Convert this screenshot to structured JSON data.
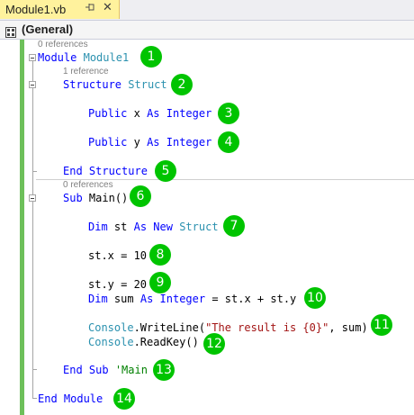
{
  "tab": {
    "title": "Module1.vb",
    "pin_icon": "pin-icon",
    "close_glyph": "✕",
    "color": "#fff29d"
  },
  "navbar": {
    "selected": "(General)",
    "icon": "class-grid-icon"
  },
  "colors": {
    "keyword": "#0000ff",
    "type": "#2b91af",
    "string": "#a31515",
    "comment": "#008000",
    "change_bar": "#6dc05a",
    "badge": "#00c400"
  },
  "code": {
    "refs_module": "0 references",
    "refs_structure": "1 reference",
    "refs_main": "0 references",
    "l1": {
      "kw": "Module",
      "name": "Module1"
    },
    "l2": {
      "kw": "Structure",
      "name": "Struct"
    },
    "l3": {
      "kw1": "Public",
      "var": "x",
      "kw2": "As",
      "kw3": "Integer"
    },
    "l4": {
      "kw1": "Public",
      "var": "y",
      "kw2": "As",
      "kw3": "Integer"
    },
    "l5": {
      "text": "End Structure"
    },
    "l6": {
      "kw": "Sub",
      "rest": "Main()"
    },
    "l7": {
      "kw1": "Dim",
      "var": "st",
      "kw2": "As New",
      "type": "Struct"
    },
    "l8": {
      "text": "st.x = 10"
    },
    "l9": {
      "text": "st.y = 20"
    },
    "l10": {
      "kw1": "Dim",
      "var": "sum",
      "kw2": "As",
      "kw3": "Integer",
      "rest": "= st.x + st.y"
    },
    "l11": {
      "type": "Console",
      "method": ".WriteLine(",
      "str": "\"The result is {0}\"",
      "rest": ", sum)"
    },
    "l12": {
      "type": "Console",
      "rest": ".ReadKey()"
    },
    "l13": {
      "kw": "End Sub",
      "comment": "'Main"
    },
    "l14": {
      "text": "End Module"
    }
  },
  "badges": [
    "1",
    "2",
    "3",
    "4",
    "5",
    "6",
    "7",
    "8",
    "9",
    "10",
    "11",
    "12",
    "13",
    "14"
  ]
}
